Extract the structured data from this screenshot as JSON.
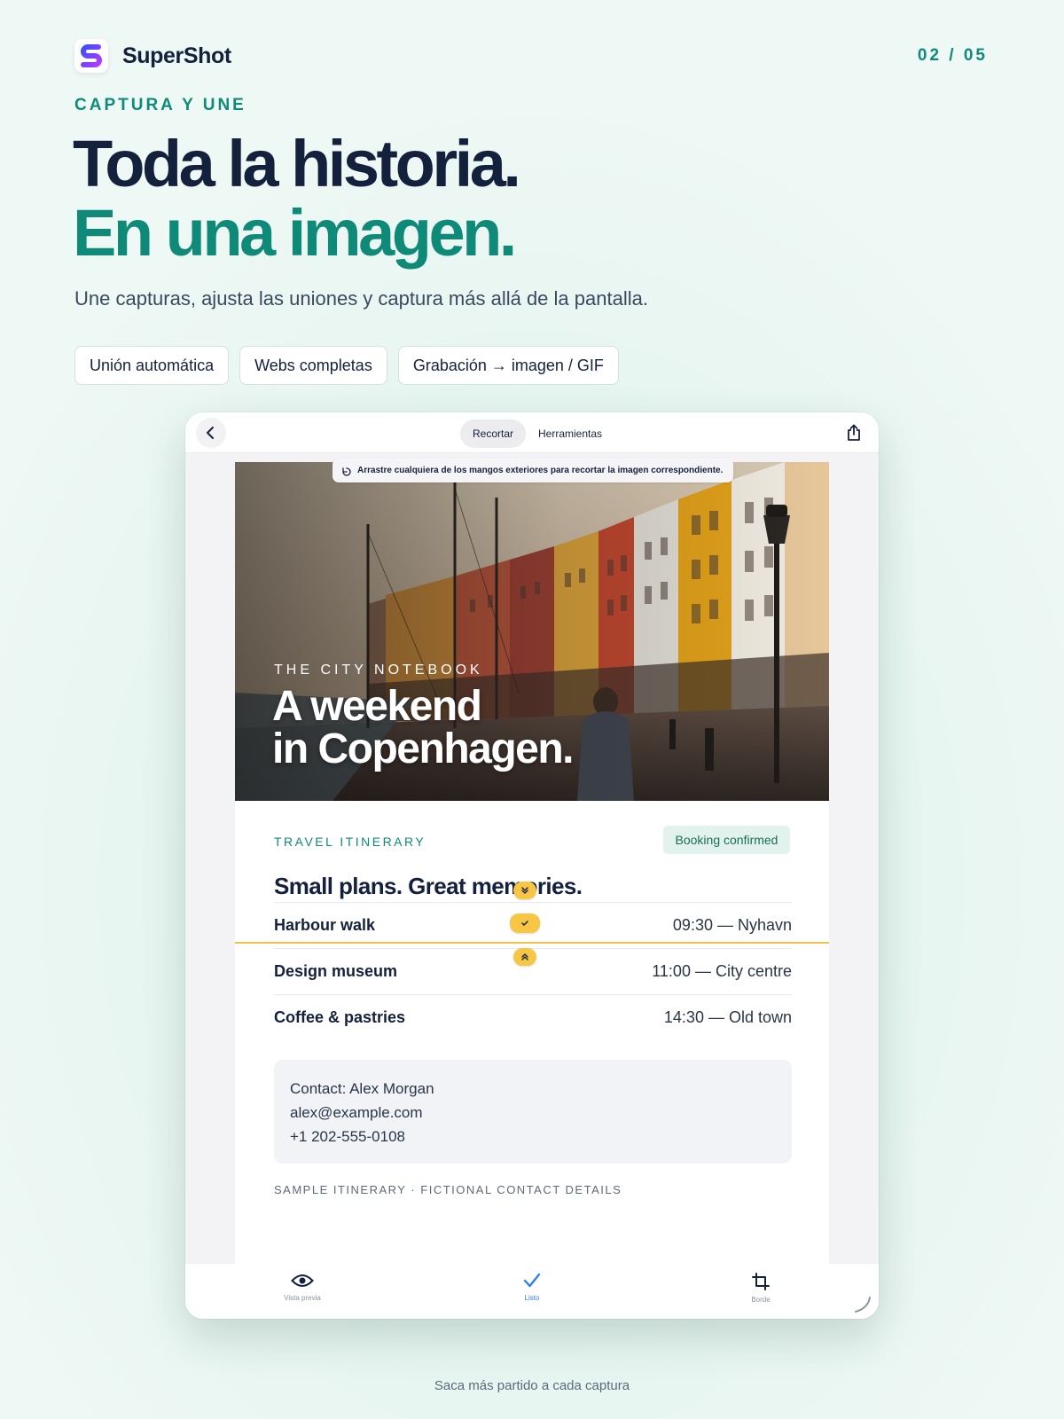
{
  "brand": {
    "name": "SuperShot"
  },
  "pager": "02 / 05",
  "eyebrow": "CAPTURA Y UNE",
  "headline": {
    "line1": "Toda la historia.",
    "line2": "En una imagen."
  },
  "subtitle": "Une capturas, ajusta las uniones y captura más allá de la pantalla.",
  "chips": [
    "Unión automática",
    "Webs completas",
    "Grabación → imagen / GIF"
  ],
  "editor": {
    "segments": [
      "Recortar",
      "Herramientas"
    ],
    "active_segment": "Recortar",
    "hint": "Arrastre cualquiera de los mangos exteriores para recortar la imagen correspondiente.",
    "bottom_tools": [
      {
        "label": "Vista previa",
        "icon": "eye-icon"
      },
      {
        "label": "Listo",
        "icon": "checkmark-icon",
        "active": true
      },
      {
        "label": "Borde",
        "icon": "crop-icon"
      }
    ]
  },
  "content": {
    "hero_kicker": "THE CITY NOTEBOOK",
    "hero_title_line1": "A weekend",
    "hero_title_line2": "in Copenhagen.",
    "itinerary_kicker": "TRAVEL ITINERARY",
    "badge": "Booking confirmed",
    "title": "Small plans. Great memories.",
    "rows": [
      {
        "name": "Harbour walk",
        "time": "09:30 — Nyhavn"
      },
      {
        "name": "Design museum",
        "time": "11:00 — City centre"
      },
      {
        "name": "Coffee & pastries",
        "time": "14:30 — Old town"
      }
    ],
    "contact": {
      "name": "Contact: Alex Morgan",
      "email": "alex@example.com",
      "phone": "+1 202-555-0108"
    },
    "footnote": "SAMPLE ITINERARY · FICTIONAL CONTACT DETAILS"
  },
  "footer": "Saca más partido a cada captura",
  "colors": {
    "accent": "#0f8a78",
    "navy": "#14213d",
    "seam": "#f2c14a",
    "done_blue": "#2f7ff0"
  }
}
